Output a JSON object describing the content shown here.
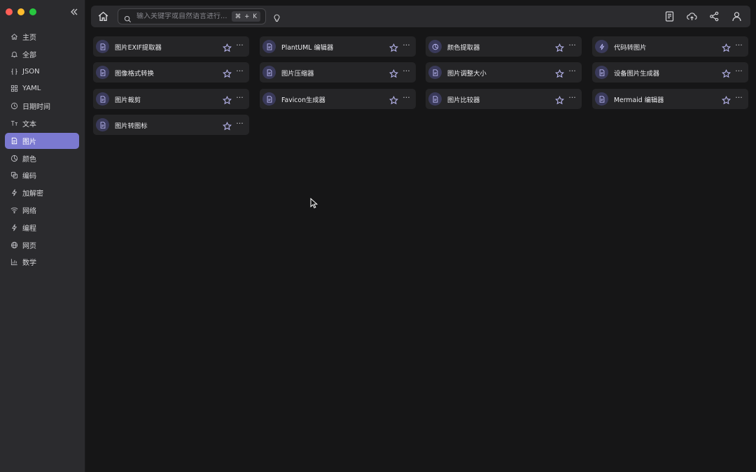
{
  "sidebar": {
    "items": [
      {
        "label": "主页",
        "icon": "home-icon",
        "active": false
      },
      {
        "label": "全部",
        "icon": "bell-icon",
        "active": false
      },
      {
        "label": "JSON",
        "icon": "json-icon",
        "active": false
      },
      {
        "label": "YAML",
        "icon": "grid-icon",
        "active": false
      },
      {
        "label": "日期时间",
        "icon": "clock-icon",
        "active": false
      },
      {
        "label": "文本",
        "icon": "text-icon",
        "active": false
      },
      {
        "label": "图片",
        "icon": "image-file-icon",
        "active": true
      },
      {
        "label": "颜色",
        "icon": "palette-icon",
        "active": false
      },
      {
        "label": "编码",
        "icon": "copy-icon",
        "active": false
      },
      {
        "label": "加解密",
        "icon": "lightning-icon",
        "active": false
      },
      {
        "label": "网络",
        "icon": "wifi-icon",
        "active": false
      },
      {
        "label": "编程",
        "icon": "lightning-icon",
        "active": false
      },
      {
        "label": "网页",
        "icon": "globe-icon",
        "active": false
      },
      {
        "label": "数学",
        "icon": "bar-chart-icon",
        "active": false
      }
    ]
  },
  "search": {
    "placeholder": "输入关键字或自然语言进行...",
    "shortcut_mod": "⌘",
    "shortcut_plus": "+",
    "shortcut_key": "K"
  },
  "tools": [
    {
      "title": "图片EXIF提取器",
      "icon": "document-icon"
    },
    {
      "title": "PlantUML 编辑器",
      "icon": "document-icon"
    },
    {
      "title": "颜色提取器",
      "icon": "palette-icon"
    },
    {
      "title": "代码转图片",
      "icon": "lightning-icon"
    },
    {
      "title": "图像格式转换",
      "icon": "document-icon"
    },
    {
      "title": "图片压缩器",
      "icon": "document-icon"
    },
    {
      "title": "图片调整大小",
      "icon": "document-icon"
    },
    {
      "title": "设备图片生成器",
      "icon": "document-icon"
    },
    {
      "title": "图片裁剪",
      "icon": "document-icon"
    },
    {
      "title": "Favicon生成器",
      "icon": "document-icon"
    },
    {
      "title": "图片比较器",
      "icon": "document-icon"
    },
    {
      "title": "Mermaid 编辑器",
      "icon": "document-icon"
    },
    {
      "title": "图片转图标",
      "icon": "document-icon"
    }
  ],
  "colors": {
    "accent": "#7b79d0",
    "sidebar_bg": "#2b2b2e",
    "main_bg": "#161617",
    "card_bg": "#252527"
  }
}
